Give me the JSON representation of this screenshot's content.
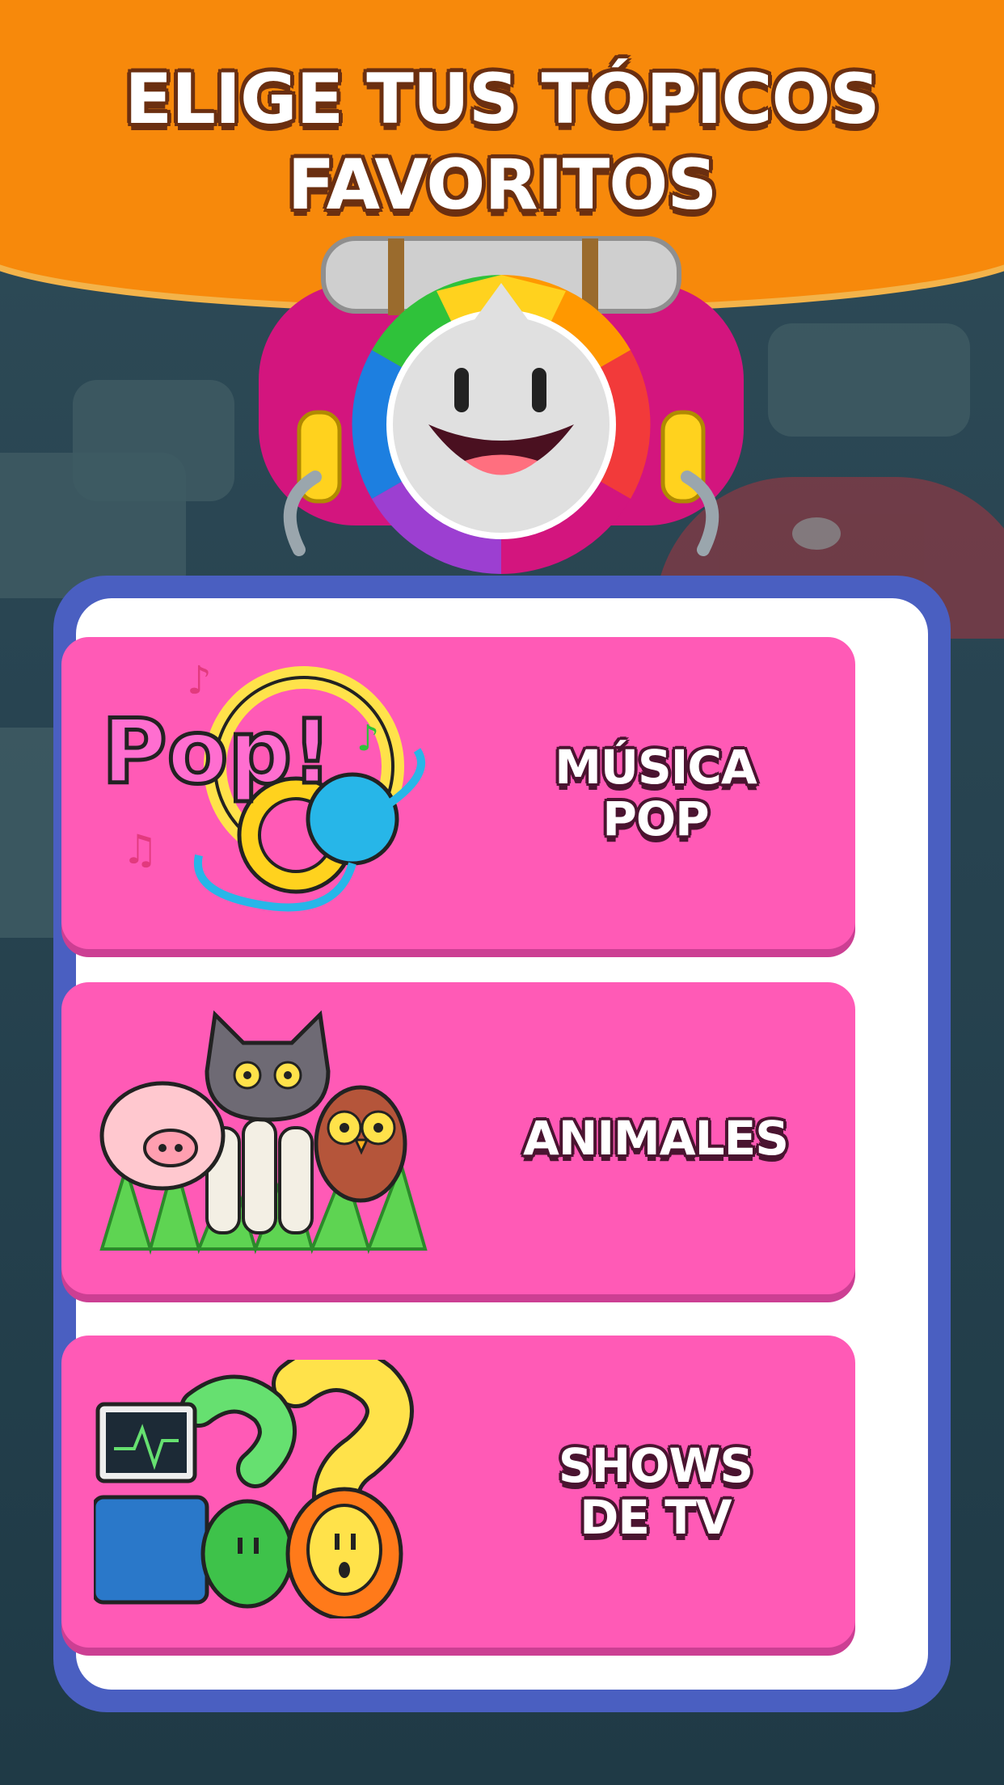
{
  "header": {
    "title": "ELIGE TUS TÓPICOS\nFAVORITOS"
  },
  "colors": {
    "header_orange": "#f7890b",
    "panel_blue": "#4a5fc1",
    "card_pink": "#ff5ab6",
    "background_teal": "#26424f"
  },
  "topics": [
    {
      "label": "MÚSICA\nPOP",
      "icon": "pop-headphones-icon"
    },
    {
      "label": "ANIMALES",
      "icon": "animals-icon"
    },
    {
      "label": "SHOWS\nDE TV",
      "icon": "tv-shows-icon"
    }
  ],
  "mascot": {
    "icon": "trivia-spinner-mascot"
  }
}
